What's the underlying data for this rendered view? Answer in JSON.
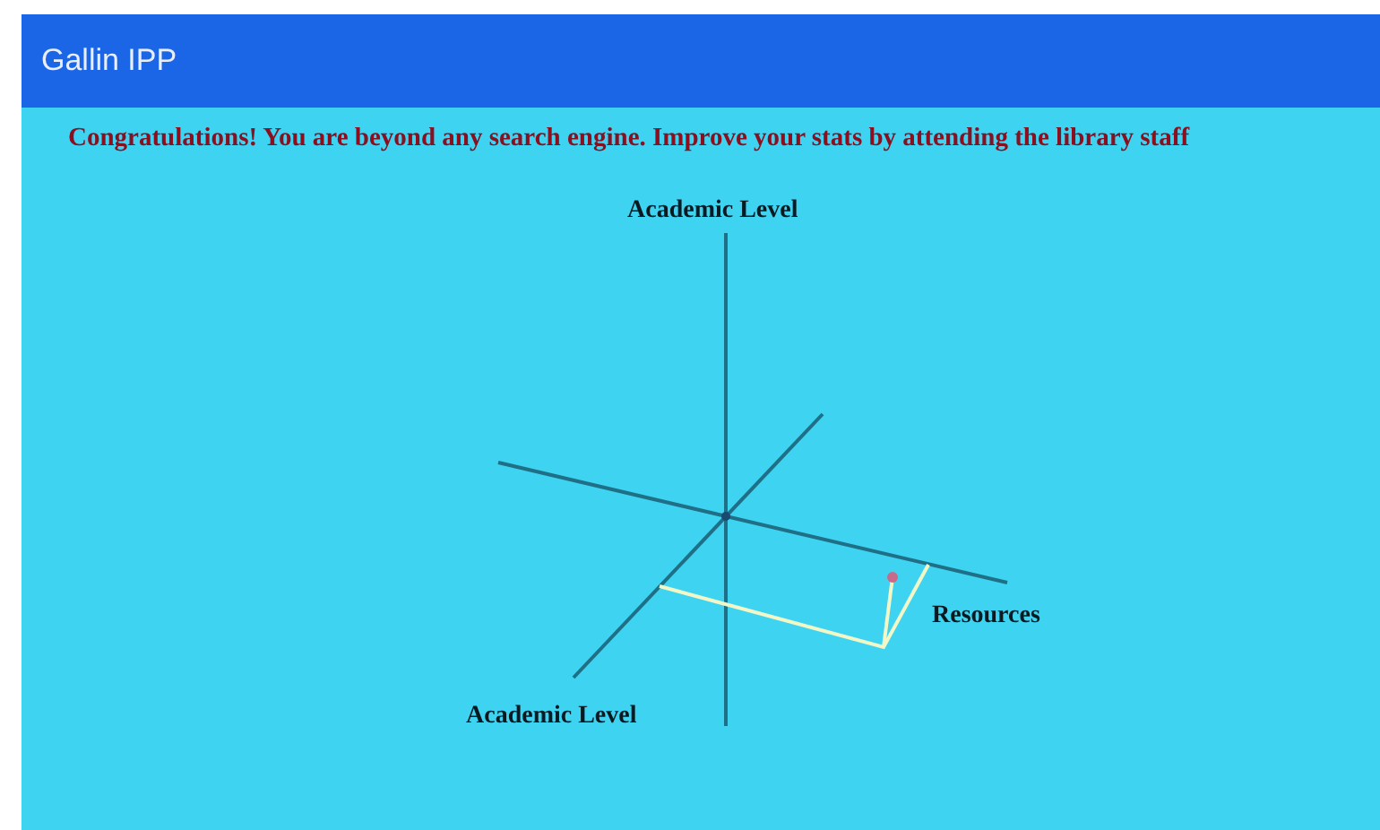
{
  "app_bar": {
    "title": "Gallin IPP"
  },
  "message": "Congratulations! You are beyond any search engine. Improve your stats by attending the library staff",
  "diagram": {
    "axis_labels": [
      "Academic Level",
      "Resources",
      "Academic Level"
    ]
  }
}
